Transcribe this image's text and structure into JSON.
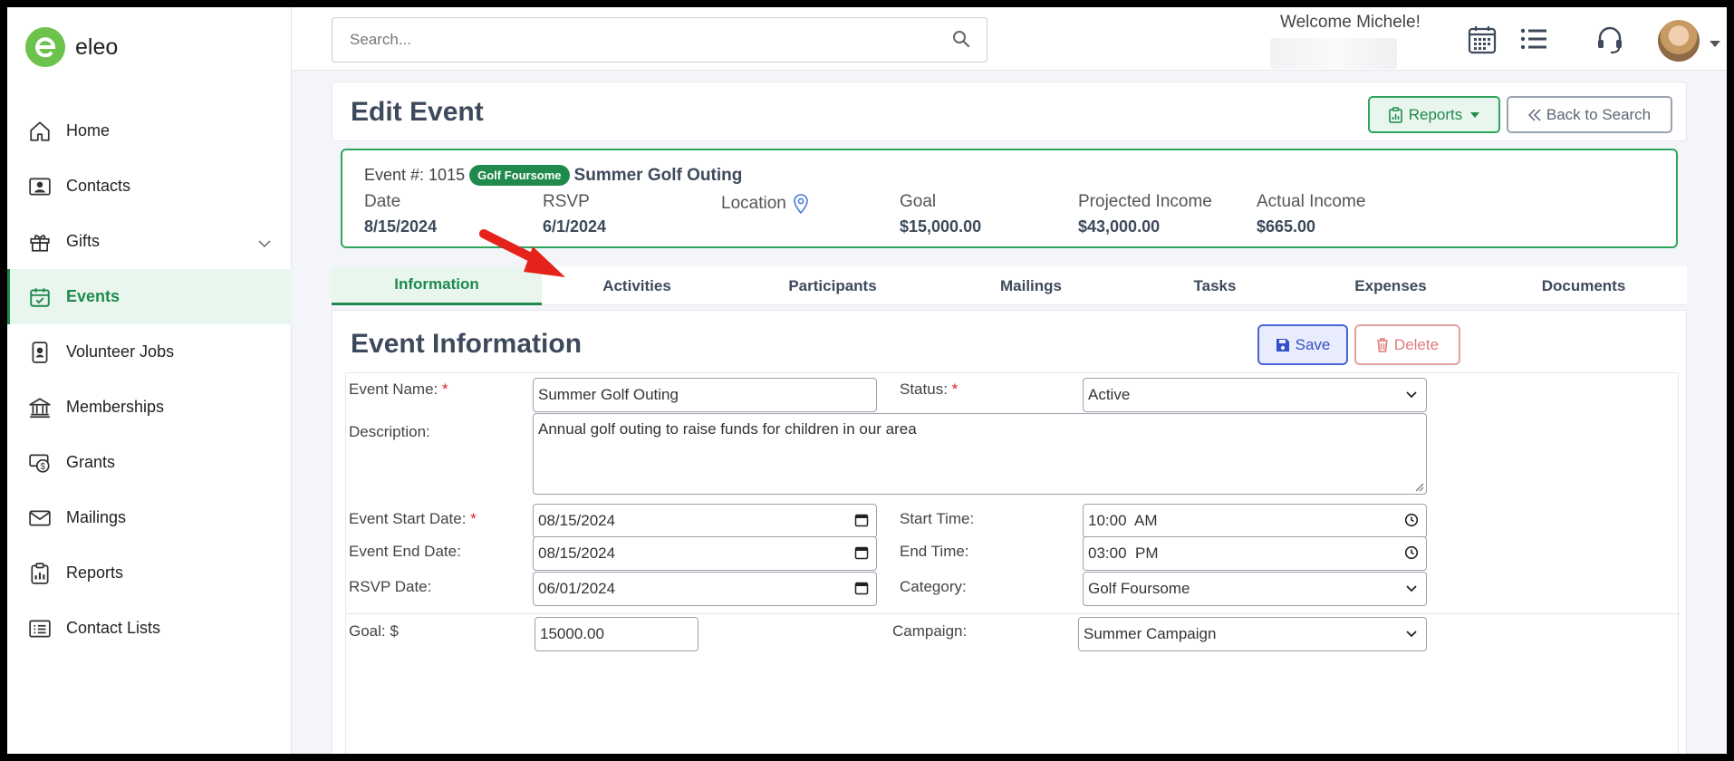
{
  "app": {
    "name": "eleo"
  },
  "sidebar": {
    "items": [
      {
        "label": "Home",
        "icon": "home-icon",
        "active": false
      },
      {
        "label": "Contacts",
        "icon": "contacts-icon",
        "active": false
      },
      {
        "label": "Gifts",
        "icon": "gift-icon",
        "active": false,
        "expandable": true
      },
      {
        "label": "Events",
        "icon": "calendar-check-icon",
        "active": true
      },
      {
        "label": "Volunteer Jobs",
        "icon": "id-badge-icon",
        "active": false
      },
      {
        "label": "Memberships",
        "icon": "institution-icon",
        "active": false
      },
      {
        "label": "Grants",
        "icon": "grants-money-icon",
        "active": false
      },
      {
        "label": "Mailings",
        "icon": "envelope-icon",
        "active": false
      },
      {
        "label": "Reports",
        "icon": "clipboard-chart-icon",
        "active": false
      },
      {
        "label": "Contact Lists",
        "icon": "list-box-icon",
        "active": false
      }
    ]
  },
  "header": {
    "search_placeholder": "Search...",
    "welcome": "Welcome Michele!",
    "icons": [
      "calendar-grid-icon",
      "list-icon",
      "headset-icon"
    ]
  },
  "page": {
    "title": "Edit Event",
    "reports_button": "Reports",
    "back_button": "Back to Search"
  },
  "event_summary": {
    "event_number_label": "Event #: 1015",
    "category_badge": "Golf Foursome",
    "event_name": "Summer Golf Outing",
    "columns": [
      {
        "label": "Date",
        "value": "8/15/2024"
      },
      {
        "label": "RSVP",
        "value": "6/1/2024"
      },
      {
        "label": "Location",
        "value": ""
      },
      {
        "label": "Goal",
        "value": "$15,000.00"
      },
      {
        "label": "Projected Income",
        "value": "$43,000.00"
      },
      {
        "label": "Actual Income",
        "value": "$665.00"
      }
    ]
  },
  "tabs": [
    {
      "label": "Information",
      "active": true
    },
    {
      "label": "Activities",
      "active": false
    },
    {
      "label": "Participants",
      "active": false
    },
    {
      "label": "Mailings",
      "active": false
    },
    {
      "label": "Tasks",
      "active": false
    },
    {
      "label": "Expenses",
      "active": false
    },
    {
      "label": "Documents",
      "active": false
    }
  ],
  "annotation": {
    "arrow_color": "#e5231b",
    "points_to": "Activities"
  },
  "event_info": {
    "title": "Event Information",
    "save_button": "Save",
    "delete_button": "Delete",
    "fields": {
      "event_name": {
        "label": "Event Name:",
        "value": "Summer Golf Outing",
        "required": true
      },
      "status": {
        "label": "Status:",
        "value": "Active",
        "required": true
      },
      "description": {
        "label": "Description:",
        "value": "Annual golf outing to raise funds for children in our area"
      },
      "start_date": {
        "label": "Event Start Date:",
        "value": "08/15/2024",
        "required": true
      },
      "start_time": {
        "label": "Start Time:",
        "value": "10:00  AM"
      },
      "end_date": {
        "label": "Event End Date:",
        "value": "08/15/2024"
      },
      "end_time": {
        "label": "End Time:",
        "value": "03:00  PM"
      },
      "rsvp_date": {
        "label": "RSVP Date:",
        "value": "06/01/2024"
      },
      "category": {
        "label": "Category:",
        "value": "Golf Foursome"
      },
      "goal": {
        "label": "Goal: $",
        "value": "15000.00"
      },
      "campaign": {
        "label": "Campaign:",
        "value": "Summer Campaign"
      }
    }
  },
  "colors": {
    "brand_green": "#1f8a4c",
    "logo_green": "#6cc24a",
    "save_blue": "#3450c8",
    "delete_red": "#e07a7a"
  }
}
